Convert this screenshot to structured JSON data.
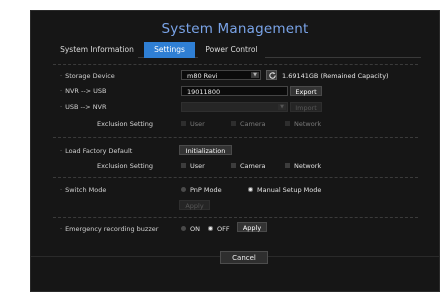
{
  "title": "System Management",
  "tabs": [
    {
      "label": "System Information",
      "active": false
    },
    {
      "label": "Settings",
      "active": true
    },
    {
      "label": "Power Control",
      "active": false
    }
  ],
  "storage": {
    "label": "Storage Device",
    "device": "m80 Revi",
    "capacity": "1.69141GB (Remained Capacity)"
  },
  "nvr_to_usb": {
    "label": "NVR --> USB",
    "value": "19011800",
    "button": "Export"
  },
  "usb_to_nvr": {
    "label": "USB --> NVR",
    "value": "",
    "button": "Import"
  },
  "exclusion_1": {
    "label": "Exclusion Setting",
    "options": [
      "User",
      "Camera",
      "Network"
    ]
  },
  "factory": {
    "label": "Load Factory Default",
    "button": "Initialization"
  },
  "exclusion_2": {
    "label": "Exclusion Setting",
    "options": [
      "User",
      "Camera",
      "Network"
    ]
  },
  "switch_mode": {
    "label": "Switch Mode",
    "options": [
      "PnP Mode",
      "Manual Setup Mode"
    ],
    "selected": "Manual Setup Mode",
    "apply": "Apply"
  },
  "buzzer": {
    "label": "Emergency recording buzzer",
    "on": "ON",
    "off": "OFF",
    "selected": "OFF",
    "apply": "Apply"
  },
  "cancel_label": "Cancel",
  "colors": {
    "accent": "#2f7fd4",
    "title": "#7aa4e8",
    "background": "#161616"
  },
  "icons": {
    "refresh": "refresh-icon",
    "dropdown": "chevron-down-icon"
  }
}
